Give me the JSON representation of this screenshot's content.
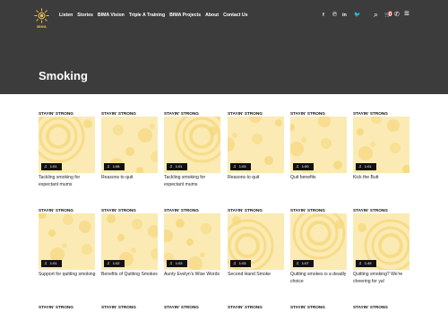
{
  "logo": {
    "text": "BIMA",
    "name": "bima-logo"
  },
  "nav": [
    {
      "label": "Listen",
      "name": "nav-listen"
    },
    {
      "label": "Stories",
      "name": "nav-stories"
    },
    {
      "label": "BIMA Vision",
      "name": "nav-bima-vision"
    },
    {
      "label": "Triple A Training",
      "name": "nav-triple-a-training"
    },
    {
      "label": "BIMA Projects",
      "name": "nav-bima-projects"
    },
    {
      "label": "About",
      "name": "nav-about"
    },
    {
      "label": "Contact Us",
      "name": "nav-contact-us"
    }
  ],
  "header_icons": [
    {
      "icon": "facebook-icon",
      "glyph": "f"
    },
    {
      "icon": "pinterest-icon",
      "glyph": "℗"
    },
    {
      "icon": "linkedin-icon",
      "glyph": "in"
    },
    {
      "icon": "twitter-icon",
      "glyph": "🐦"
    },
    {
      "icon": "search-icon",
      "glyph": "⌕"
    },
    {
      "icon": "cart-icon",
      "glyph": "🛒",
      "badge": "0"
    },
    {
      "icon": "phone-icon",
      "glyph": "✆"
    },
    {
      "icon": "menu-icon",
      "glyph": "≡"
    }
  ],
  "page": {
    "title": "Smoking"
  },
  "colors": {
    "hero_bg": "#3c3c3c",
    "thumb_bg": "#fbeab3",
    "thumb_pattern": "#f5d77a",
    "accent": "#f0c64a"
  },
  "cards": [
    {
      "category": "STAYIN' STRONG",
      "duration": "1:01",
      "title": "Tackling smoking for expectant mums"
    },
    {
      "category": "STAYIN' STRONG",
      "duration": "1:06",
      "title": "Reasons to quit"
    },
    {
      "category": "STAYIN' STRONG",
      "duration": "1:01",
      "title": "Tackling smoking for expectant mums"
    },
    {
      "category": "STAYIN' STRONG",
      "duration": "1:03",
      "title": "Reasons to quit"
    },
    {
      "category": "STAYIN' STRONG",
      "duration": "1:00",
      "title": "Quit benefits"
    },
    {
      "category": "STAYIN' STRONG",
      "duration": "1:01",
      "title": "Kick the Butt"
    },
    {
      "category": "STAYIN' STRONG",
      "duration": "1:01",
      "title": "Support for quitting smoking"
    },
    {
      "category": "STAYIN' STRONG",
      "duration": "1:02",
      "title": "Benefits of Quitting Smokes"
    },
    {
      "category": "STAYIN' STRONG",
      "duration": "1:03",
      "title": "Aunty Evelyn's Wise Words"
    },
    {
      "category": "STAYIN' STRONG",
      "duration": "1:03",
      "title": "Second Hand Smoke"
    },
    {
      "category": "STAYIN' STRONG",
      "duration": "1:07",
      "title": "Quitting smokes is a deadly choice"
    },
    {
      "category": "STAYIN' STRONG",
      "duration": "1:49",
      "title": "Quitting smoking? We're cheering for ya!"
    },
    {
      "category": "STAYIN' STRONG",
      "duration": "",
      "title": ""
    },
    {
      "category": "STAYIN' STRONG",
      "duration": "",
      "title": ""
    },
    {
      "category": "STAYIN' STRONG",
      "duration": "",
      "title": ""
    },
    {
      "category": "STAYIN' STRONG",
      "duration": "",
      "title": ""
    },
    {
      "category": "STAYIN' STRONG",
      "duration": "",
      "title": ""
    },
    {
      "category": "STAYIN' STRONG",
      "duration": "",
      "title": ""
    }
  ]
}
